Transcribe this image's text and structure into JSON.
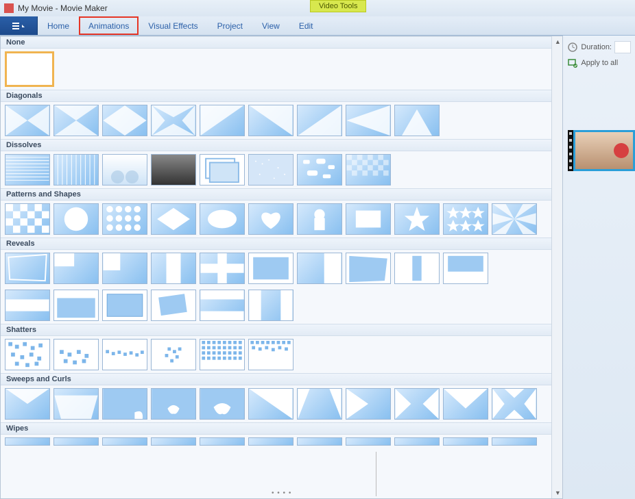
{
  "title": "My Movie - Movie Maker",
  "contextual_tab": "Video Tools",
  "tabs": {
    "home": "Home",
    "animations": "Animations",
    "visual_effects": "Visual Effects",
    "project": "Project",
    "view": "View",
    "edit": "Edit"
  },
  "options": {
    "duration_label": "Duration:",
    "apply_all": "Apply to all"
  },
  "categories": {
    "none": "None",
    "diagonals": "Diagonals",
    "dissolves": "Dissolves",
    "patterns": "Patterns and Shapes",
    "reveals": "Reveals",
    "shatters": "Shatters",
    "sweeps": "Sweeps and Curls",
    "wipes": "Wipes"
  }
}
